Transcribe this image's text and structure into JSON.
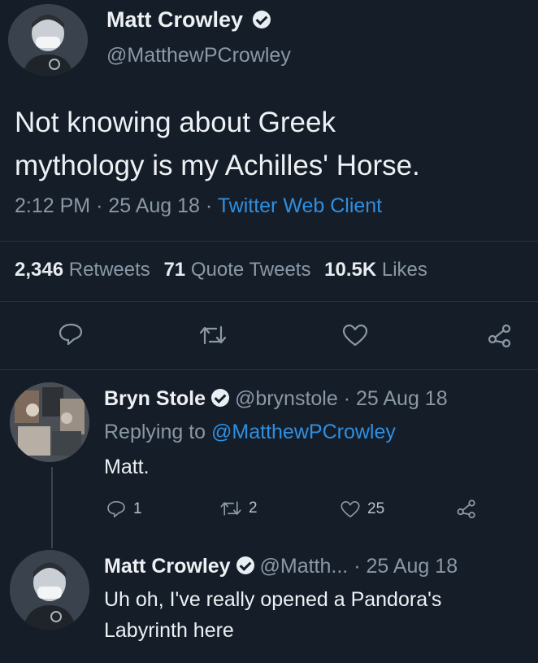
{
  "main_tweet": {
    "author_name": "Matt Crowley",
    "handle": "@MatthewPCrowley",
    "text_line1": "Not knowing about Greek",
    "text_line2": "mythology is my Achilles' Horse.",
    "time": "2:12 PM",
    "date": "25 Aug 18",
    "client": "Twitter Web Client",
    "stats": {
      "retweets_count": "2,346",
      "retweets_label": "Retweets",
      "quotes_count": "71",
      "quotes_label": "Quote Tweets",
      "likes_count": "10.5K",
      "likes_label": "Likes"
    },
    "actions": [
      "reply-icon",
      "retweet-icon",
      "like-icon",
      "share-icon"
    ]
  },
  "reply1": {
    "author_name": "Bryn Stole",
    "handle": "@brynstole",
    "date": "25 Aug 18",
    "replying_prefix": "Replying to",
    "replying_handle": "@MatthewPCrowley",
    "text": "Matt.",
    "reply_count": "1",
    "retweet_count": "2",
    "like_count": "25"
  },
  "reply2": {
    "author_name": "Matt Crowley",
    "handle": "@Matth...",
    "date": "25 Aug 18",
    "text_line1": "Uh oh, I've really opened a Pandora's",
    "text_line2": "Labyrinth here"
  },
  "colors": {
    "background": "#151d29",
    "link": "#2f8fe0",
    "muted": "#8a98a6"
  }
}
